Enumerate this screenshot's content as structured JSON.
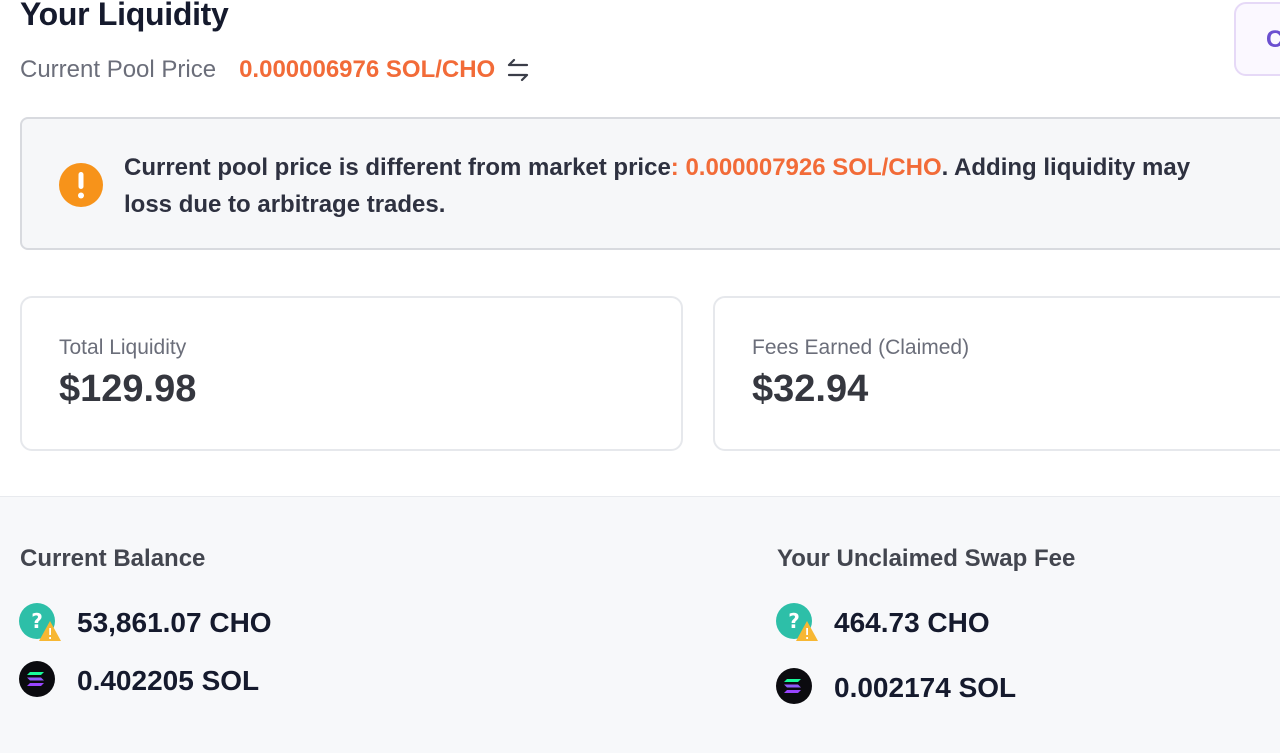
{
  "header": {
    "title": "Your Liquidity",
    "pool_price_label": "Current Pool Price",
    "pool_price_value": "0.000006976 SOL/CHO",
    "top_right_button_label": "C"
  },
  "alert": {
    "text_part1": "Current pool price is different from market price",
    "market_price": ": 0.000007926 SOL/CHO",
    "text_part2": ". Adding liquidity may",
    "text_line2": "loss due to arbitrage trades."
  },
  "stats": {
    "total_liquidity": {
      "label": "Total Liquidity",
      "value": "$129.98"
    },
    "fees_earned": {
      "label": "Fees Earned (Claimed)",
      "value": "$32.94"
    }
  },
  "current_balance": {
    "title": "Current Balance",
    "items": [
      {
        "amount": "53,861.07 CHO",
        "icon": "unknown-token-warning-icon"
      },
      {
        "amount": "0.402205 SOL",
        "icon": "solana-icon"
      }
    ]
  },
  "unclaimed_fee": {
    "title": "Your Unclaimed Swap Fee",
    "items": [
      {
        "amount": "464.73 CHO",
        "icon": "unknown-token-warning-icon"
      },
      {
        "amount": "0.002174 SOL",
        "icon": "solana-icon"
      }
    ]
  },
  "colors": {
    "accent_orange": "#f26b38",
    "warning_orange": "#f7931a",
    "token_teal": "#2dbfa8"
  }
}
